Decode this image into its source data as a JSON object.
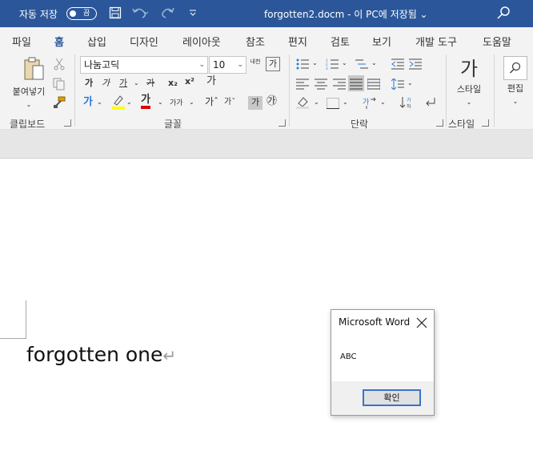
{
  "titlebar": {
    "autosave_label": "자동 저장",
    "autosave_state": "끔",
    "document_title": "forgotten2.docm - 이 PC에 저장됨 ⌄",
    "icons": [
      "save-icon",
      "undo-icon",
      "redo-icon",
      "customize-qat-icon",
      "search-icon"
    ],
    "background": "#2b579a"
  },
  "tabs": [
    {
      "label": "파일",
      "active": false
    },
    {
      "label": "홈",
      "active": true
    },
    {
      "label": "삽입",
      "active": false
    },
    {
      "label": "디자인",
      "active": false
    },
    {
      "label": "레이아웃",
      "active": false
    },
    {
      "label": "참조",
      "active": false
    },
    {
      "label": "편지",
      "active": false
    },
    {
      "label": "검토",
      "active": false
    },
    {
      "label": "보기",
      "active": false
    },
    {
      "label": "개발 도구",
      "active": false
    },
    {
      "label": "도움말",
      "active": false
    }
  ],
  "ribbon": {
    "clipboard": {
      "paste_label": "붙여넣기",
      "group_label": "클립보드"
    },
    "font": {
      "font_name": "나눔고딕",
      "font_size": "10",
      "bold": "가",
      "italic": "가",
      "underline": "가",
      "strike": "가",
      "subscript": "x₂",
      "superscript": "x²",
      "clear_format": "가",
      "text_effects": "가",
      "highlight": "가",
      "font_color": "가",
      "case": "가가",
      "grow": "가ˆ",
      "shrink": "가ˇ",
      "char_shading": "가",
      "enclose": "㉮",
      "phonetic": "내천",
      "char_border": "가",
      "group_label": "글꼴"
    },
    "paragraph": {
      "group_label": "단락"
    },
    "styles": {
      "button_label": "스타일",
      "glyph": "가",
      "group_label": "스타일"
    },
    "editing": {
      "button_label": "편집"
    }
  },
  "document": {
    "text": "forgotten one",
    "paragraph_mark": "↵"
  },
  "dialog": {
    "title": "Microsoft Word",
    "message": "ABC",
    "ok_label": "확인"
  }
}
